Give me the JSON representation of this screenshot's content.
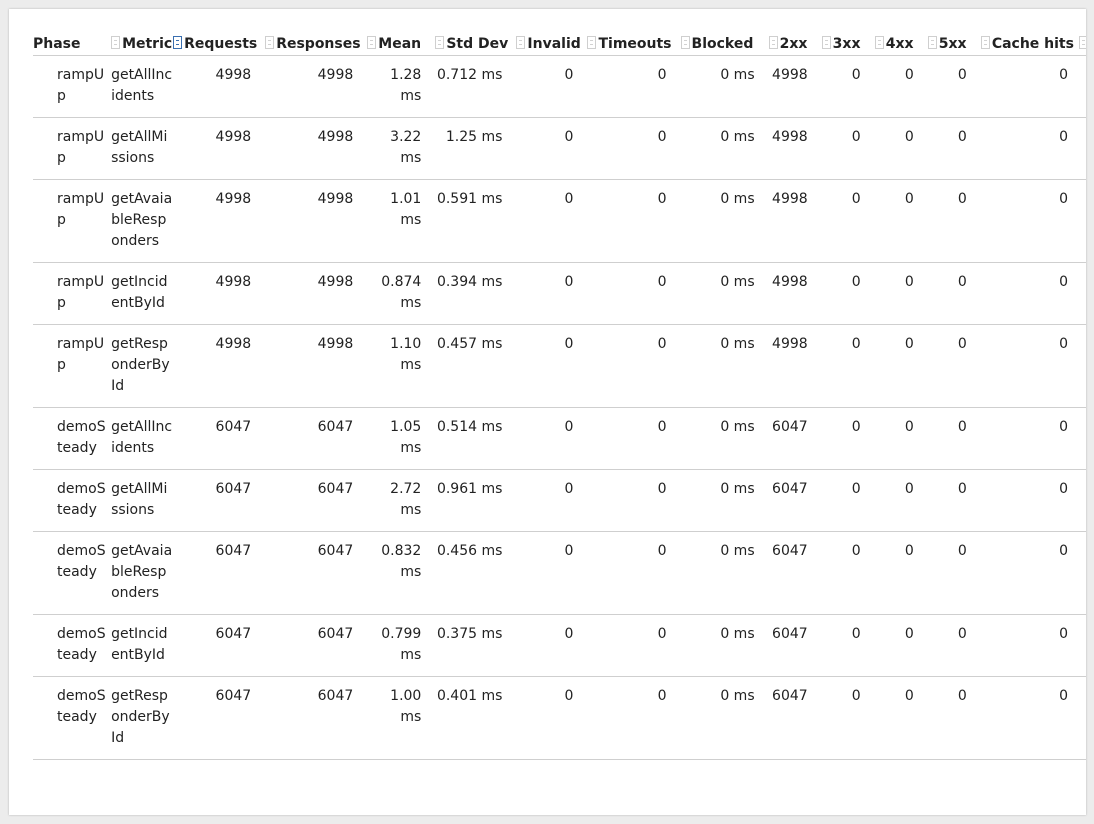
{
  "columns": [
    "Phase",
    "Metric",
    "Requests",
    "Responses",
    "Mean",
    "Std Dev",
    "Invalid",
    "Timeouts",
    "Blocked",
    "2xx",
    "3xx",
    "4xx",
    "5xx",
    "Cache hits"
  ],
  "rows": [
    {
      "phase": "rampUp",
      "metric": "getAllIncidents",
      "requests": "4998",
      "responses": "4998",
      "mean": "1.28 ms",
      "stddev": "0.712 ms",
      "invalid": "0",
      "timeouts": "0",
      "blocked": "0 ms",
      "s2xx": "4998",
      "s3xx": "0",
      "s4xx": "0",
      "s5xx": "0",
      "cache": "0"
    },
    {
      "phase": "rampUp",
      "metric": "getAllMissions",
      "requests": "4998",
      "responses": "4998",
      "mean": "3.22 ms",
      "stddev": "1.25 ms",
      "invalid": "0",
      "timeouts": "0",
      "blocked": "0 ms",
      "s2xx": "4998",
      "s3xx": "0",
      "s4xx": "0",
      "s5xx": "0",
      "cache": "0"
    },
    {
      "phase": "rampUp",
      "metric": "getAvaiableResponders",
      "requests": "4998",
      "responses": "4998",
      "mean": "1.01 ms",
      "stddev": "0.591 ms",
      "invalid": "0",
      "timeouts": "0",
      "blocked": "0 ms",
      "s2xx": "4998",
      "s3xx": "0",
      "s4xx": "0",
      "s5xx": "0",
      "cache": "0"
    },
    {
      "phase": "rampUp",
      "metric": "getIncidentById",
      "requests": "4998",
      "responses": "4998",
      "mean": "0.874 ms",
      "stddev": "0.394 ms",
      "invalid": "0",
      "timeouts": "0",
      "blocked": "0 ms",
      "s2xx": "4998",
      "s3xx": "0",
      "s4xx": "0",
      "s5xx": "0",
      "cache": "0"
    },
    {
      "phase": "rampUp",
      "metric": "getResponderById",
      "requests": "4998",
      "responses": "4998",
      "mean": "1.10 ms",
      "stddev": "0.457 ms",
      "invalid": "0",
      "timeouts": "0",
      "blocked": "0 ms",
      "s2xx": "4998",
      "s3xx": "0",
      "s4xx": "0",
      "s5xx": "0",
      "cache": "0"
    },
    {
      "phase": "demoSteady",
      "metric": "getAllIncidents",
      "requests": "6047",
      "responses": "6047",
      "mean": "1.05 ms",
      "stddev": "0.514 ms",
      "invalid": "0",
      "timeouts": "0",
      "blocked": "0 ms",
      "s2xx": "6047",
      "s3xx": "0",
      "s4xx": "0",
      "s5xx": "0",
      "cache": "0"
    },
    {
      "phase": "demoSteady",
      "metric": "getAllMissions",
      "requests": "6047",
      "responses": "6047",
      "mean": "2.72 ms",
      "stddev": "0.961 ms",
      "invalid": "0",
      "timeouts": "0",
      "blocked": "0 ms",
      "s2xx": "6047",
      "s3xx": "0",
      "s4xx": "0",
      "s5xx": "0",
      "cache": "0"
    },
    {
      "phase": "demoSteady",
      "metric": "getAvaiableResponders",
      "requests": "6047",
      "responses": "6047",
      "mean": "0.832 ms",
      "stddev": "0.456 ms",
      "invalid": "0",
      "timeouts": "0",
      "blocked": "0 ms",
      "s2xx": "6047",
      "s3xx": "0",
      "s4xx": "0",
      "s5xx": "0",
      "cache": "0"
    },
    {
      "phase": "demoSteady",
      "metric": "getIncidentById",
      "requests": "6047",
      "responses": "6047",
      "mean": "0.799 ms",
      "stddev": "0.375 ms",
      "invalid": "0",
      "timeouts": "0",
      "blocked": "0 ms",
      "s2xx": "6047",
      "s3xx": "0",
      "s4xx": "0",
      "s5xx": "0",
      "cache": "0"
    },
    {
      "phase": "demoSteady",
      "metric": "getResponderById",
      "requests": "6047",
      "responses": "6047",
      "mean": "1.00 ms",
      "stddev": "0.401 ms",
      "invalid": "0",
      "timeouts": "0",
      "blocked": "0 ms",
      "s2xx": "6047",
      "s3xx": "0",
      "s4xx": "0",
      "s5xx": "0",
      "cache": "0"
    }
  ]
}
